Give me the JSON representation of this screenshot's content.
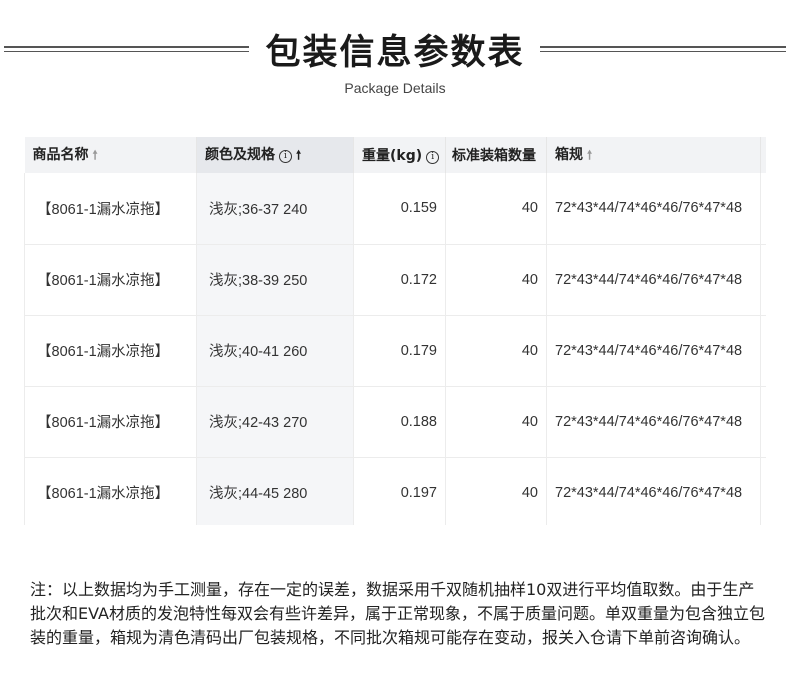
{
  "header": {
    "title": "包装信息参数表",
    "subtitle": "Package Details"
  },
  "table": {
    "columns": [
      {
        "label": "商品名称",
        "sort": "asc",
        "info": false
      },
      {
        "label": "颜色及规格",
        "sort": "asc-active",
        "info": true
      },
      {
        "label": "重量(kg)",
        "sort": "asc",
        "info": true
      },
      {
        "label": "标准装箱数量",
        "sort": "none",
        "info": false
      },
      {
        "label": "箱规",
        "sort": "asc",
        "info": false
      }
    ],
    "rows": [
      {
        "name": "【8061-1漏水凉拖】",
        "spec": "浅灰;36-37 240",
        "weight": "0.159",
        "qty": "40",
        "box": "72*43*44/74*46*46/76*47*48"
      },
      {
        "name": "【8061-1漏水凉拖】",
        "spec": "浅灰;38-39 250",
        "weight": "0.172",
        "qty": "40",
        "box": "72*43*44/74*46*46/76*47*48"
      },
      {
        "name": "【8061-1漏水凉拖】",
        "spec": "浅灰;40-41 260",
        "weight": "0.179",
        "qty": "40",
        "box": "72*43*44/74*46*46/76*47*48"
      },
      {
        "name": "【8061-1漏水凉拖】",
        "spec": "浅灰;42-43 270",
        "weight": "0.188",
        "qty": "40",
        "box": "72*43*44/74*46*46/76*47*48"
      },
      {
        "name": "【8061-1漏水凉拖】",
        "spec": "浅灰;44-45 280",
        "weight": "0.197",
        "qty": "40",
        "box": "72*43*44/74*46*46/76*47*48"
      }
    ]
  },
  "note": "注：以上数据均为手工测量，存在一定的误差，数据采用千双随机抽样10双进行平均值取数。由于生产批次和EVA材质的发泡特性每双会有些许差异，属于正常现象，不属于质量问题。单双重量为包含独立包装的重量，箱规为清色清码出厂包装规格，不同批次箱规可能存在变动，报关入仓请下单前咨询确认。",
  "icons": {
    "sort": "sort-arrow-up-icon",
    "info": "info-circle-icon"
  }
}
